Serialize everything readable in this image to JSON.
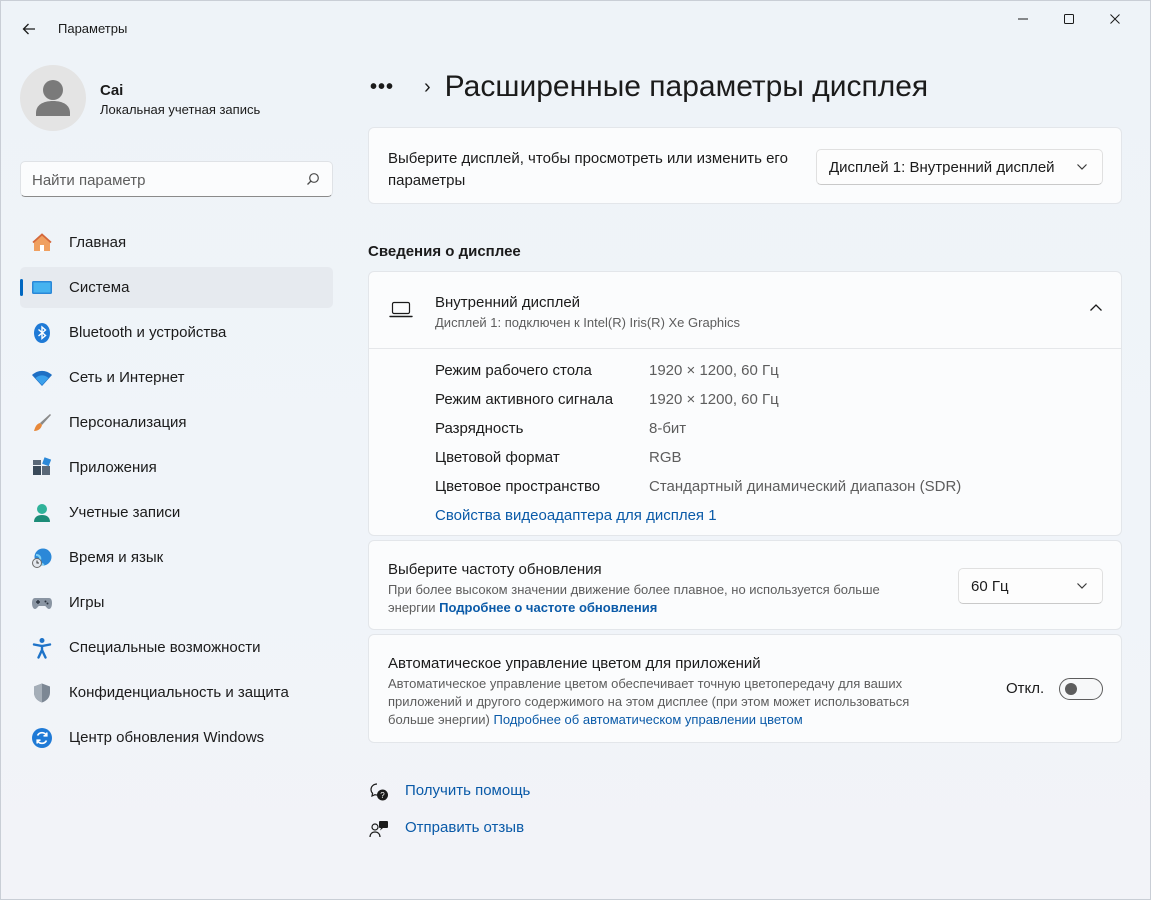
{
  "window": {
    "title": "Параметры"
  },
  "user": {
    "name": "Cai",
    "account_type": "Локальная учетная запись"
  },
  "search": {
    "placeholder": "Найти параметр"
  },
  "sidebar": {
    "items": [
      {
        "label": "Главная",
        "icon": "home-icon",
        "active": false
      },
      {
        "label": "Система",
        "icon": "system-icon",
        "active": true
      },
      {
        "label": "Bluetooth и устройства",
        "icon": "bluetooth-icon",
        "active": false
      },
      {
        "label": "Сеть и Интернет",
        "icon": "wifi-icon",
        "active": false
      },
      {
        "label": "Персонализация",
        "icon": "brush-icon",
        "active": false
      },
      {
        "label": "Приложения",
        "icon": "apps-icon",
        "active": false
      },
      {
        "label": "Учетные записи",
        "icon": "accounts-icon",
        "active": false
      },
      {
        "label": "Время и язык",
        "icon": "time-language-icon",
        "active": false
      },
      {
        "label": "Игры",
        "icon": "gamepad-icon",
        "active": false
      },
      {
        "label": "Специальные возможности",
        "icon": "accessibility-icon",
        "active": false
      },
      {
        "label": "Конфиденциальность и защита",
        "icon": "shield-icon",
        "active": false
      },
      {
        "label": "Центр обновления Windows",
        "icon": "update-icon",
        "active": false
      }
    ]
  },
  "breadcrumb": {
    "overflow": "•••",
    "separator": "›",
    "title": "Расширенные параметры дисплея"
  },
  "display_select": {
    "label": "Выберите дисплей, чтобы просмотреть или изменить его параметры",
    "selected": "Дисплей 1: Внутренний дисплей"
  },
  "display_info": {
    "section_title": "Сведения о дисплее",
    "name": "Внутренний дисплей",
    "connection": "Дисплей 1: подключен к Intel(R) Iris(R) Xe Graphics",
    "rows": [
      {
        "key": "Режим рабочего стола",
        "value": "1920 × 1200, 60 Гц"
      },
      {
        "key": "Режим активного сигнала",
        "value": "1920 × 1200, 60 Гц"
      },
      {
        "key": "Разрядность",
        "value": "8-бит"
      },
      {
        "key": "Цветовой формат",
        "value": "RGB"
      },
      {
        "key": "Цветовое пространство",
        "value": "Стандартный динамический диапазон (SDR)"
      }
    ],
    "adapter_link": "Свойства видеоадаптера для дисплея 1"
  },
  "refresh_rate": {
    "title": "Выберите частоту обновления",
    "description": "При более высоком значении движение более плавное, но используется больше энергии",
    "link": "Подробнее о частоте обновления",
    "selected": "60 Гц"
  },
  "auto_color": {
    "title": "Автоматическое управление цветом для приложений",
    "description": "Автоматическое управление цветом обеспечивает точную цветопередачу для ваших приложений и другого содержимого на этом дисплее (при этом может использоваться больше энергии)",
    "link": "Подробнее об автоматическом управлении цветом",
    "toggle_label": "Откл.",
    "toggle_on": false
  },
  "help": {
    "get_help": "Получить помощь",
    "feedback": "Отправить отзыв"
  },
  "colors": {
    "accent": "#0067c0",
    "link": "#0a5aa8",
    "background": "#eef3f8",
    "card": "#fbfcfd"
  }
}
